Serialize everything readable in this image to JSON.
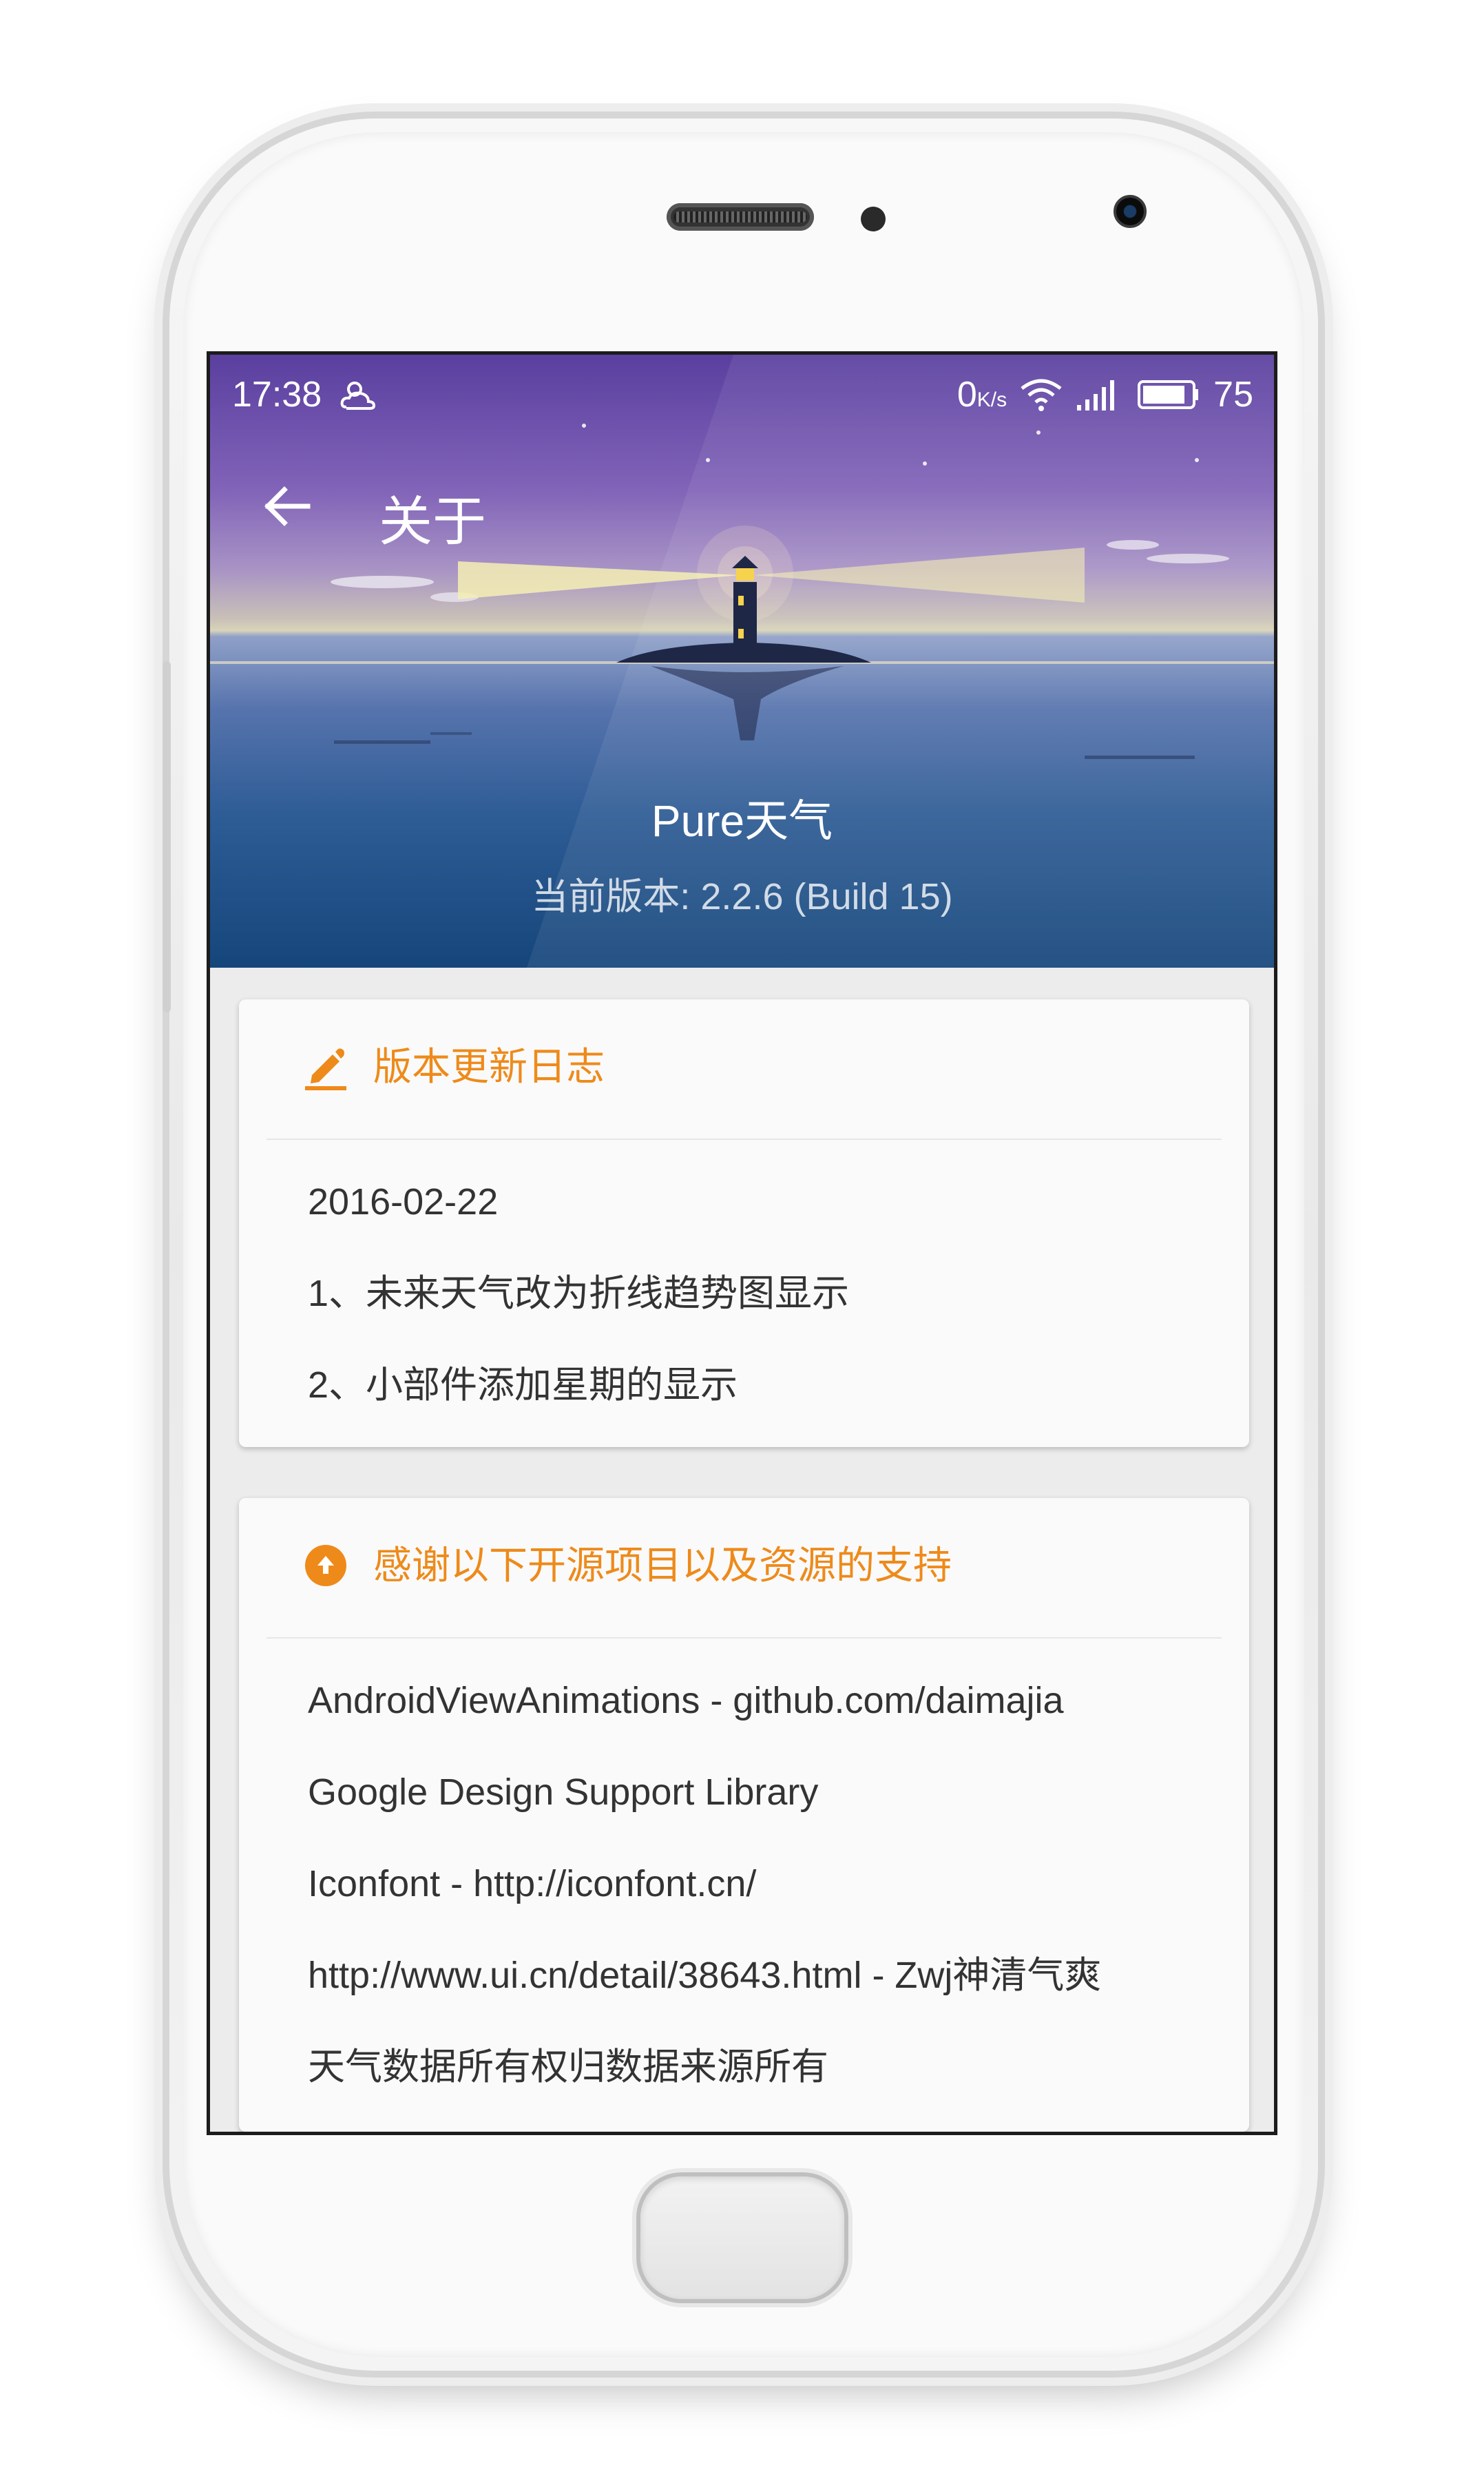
{
  "status_bar": {
    "time": "17:38",
    "weather_icon": "partly-cloudy-icon",
    "network_speed": "0",
    "network_unit": "K/s",
    "wifi_icon": "wifi-icon",
    "signal_icon": "signal-icon",
    "battery_icon": "battery-icon",
    "battery_level": "75"
  },
  "toolbar": {
    "back_icon": "arrow-left-icon",
    "title": "关于"
  },
  "header": {
    "app_name": "Pure天气",
    "version": "当前版本: 2.2.6 (Build 15)"
  },
  "changelog": {
    "icon": "pencil-icon",
    "title": "版本更新日志",
    "items": [
      "2016-02-22",
      "1、未来天气改为折线趋势图显示",
      "2、小部件添加星期的显示"
    ]
  },
  "credits": {
    "icon": "upload-circle-icon",
    "title": "感谢以下开源项目以及资源的支持",
    "items": [
      "AndroidViewAnimations - github.com/daimajia",
      "Google Design Support Library",
      "Iconfont - http://iconfont.cn/",
      "http://www.ui.cn/detail/38643.html - Zwj神清气爽",
      "天气数据所有权归数据来源所有"
    ]
  },
  "colors": {
    "accent": "#ee8a1a",
    "text": "#333333"
  }
}
